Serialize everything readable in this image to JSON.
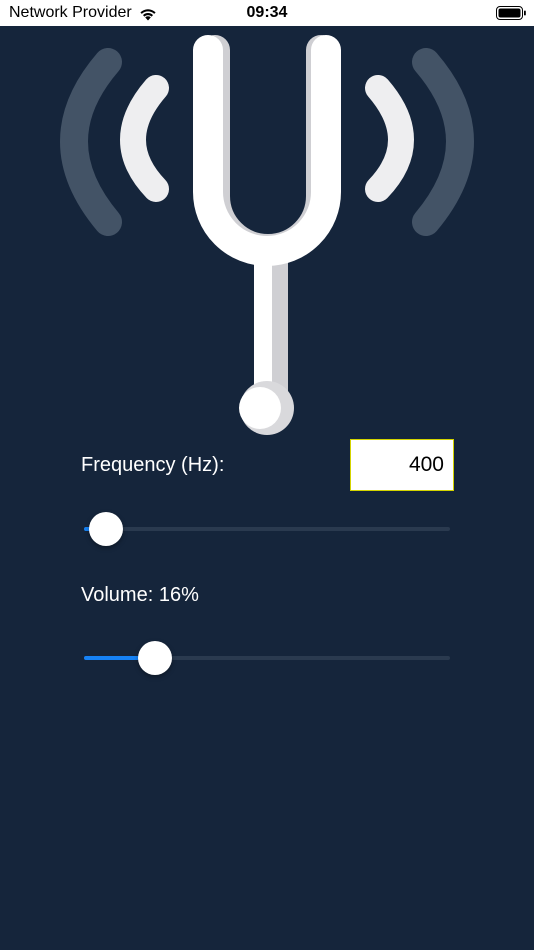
{
  "status_bar": {
    "carrier": "Network Provider",
    "time": "09:34",
    "wifi_icon": "wifi-icon",
    "battery_icon": "battery-icon"
  },
  "illustration": {
    "icon": "tuning-fork-icon"
  },
  "frequency": {
    "label": "Frequency (Hz):",
    "value": "400",
    "slider_fraction": 0.06
  },
  "volume": {
    "prefix": "Volume:",
    "value_text": "16%",
    "slider_fraction": 0.195
  },
  "colors": {
    "background": "#15253b",
    "accent": "#1682f5",
    "track": "#2a3a4f",
    "input_border": "#d4d400"
  }
}
